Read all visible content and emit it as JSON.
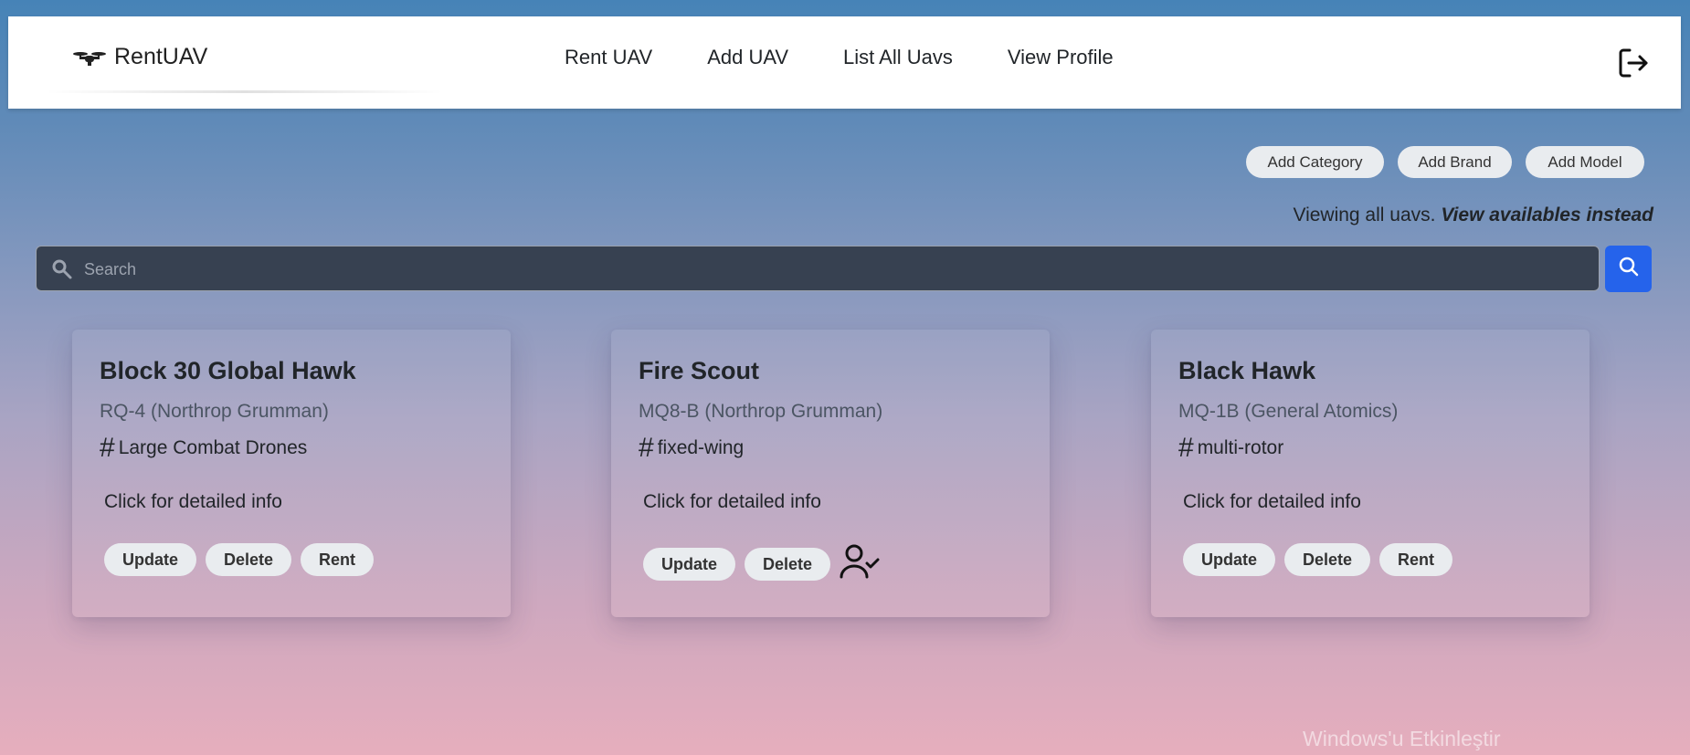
{
  "navbar": {
    "brand": "RentUAV",
    "links": [
      {
        "label": "Rent UAV"
      },
      {
        "label": "Add UAV"
      },
      {
        "label": "List All Uavs"
      },
      {
        "label": "View Profile"
      }
    ],
    "logout_icon": "logout-icon"
  },
  "toolbar": {
    "add_category": "Add Category",
    "add_brand": "Add Brand",
    "add_model": "Add Model"
  },
  "viewing": {
    "text": "Viewing all uavs.",
    "link": "View availables instead"
  },
  "search": {
    "placeholder": "Search",
    "value": ""
  },
  "cards": [
    {
      "title": "Block 30 Global Hawk",
      "model": "RQ-4 (Northrop Grumman)",
      "category": "Large Combat Drones",
      "info": "Click for detailed info",
      "actions": [
        "Update",
        "Delete",
        "Rent"
      ]
    },
    {
      "title": "Fire Scout",
      "model": "MQ8-B (Northrop Grumman)",
      "category": "fixed-wing",
      "info": "Click for detailed info",
      "actions": [
        "Update",
        "Delete"
      ],
      "status_icon": "user-check-icon"
    },
    {
      "title": "Black Hawk",
      "model": "MQ-1B (General Atomics)",
      "category": "multi-rotor",
      "info": "Click for detailed info",
      "actions": [
        "Update",
        "Delete",
        "Rent"
      ]
    }
  ],
  "watermark": "Windows'u Etkinleştir",
  "colors": {
    "search_button": "#2563eb",
    "search_bar": "#374151"
  }
}
